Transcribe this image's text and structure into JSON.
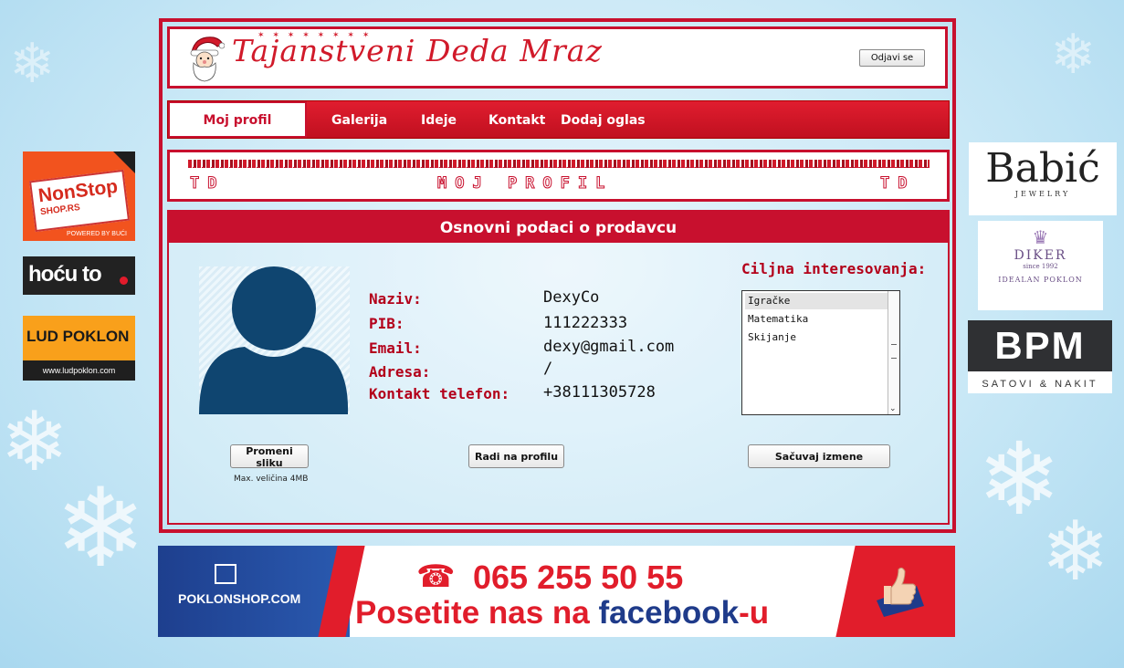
{
  "site": {
    "title": "Tajanstveni Deda Mraz",
    "logout_label": "Odjavi se"
  },
  "nav": {
    "items": [
      {
        "label": "Moj profil",
        "active": true
      },
      {
        "label": "Galerija"
      },
      {
        "label": "Ideje"
      },
      {
        "label": "Kontakt"
      },
      {
        "label": "Dodaj oglas"
      }
    ]
  },
  "banner": {
    "left": "TD",
    "main": "MOJ PROFIL",
    "right": "TD"
  },
  "panel": {
    "heading": "Osnovni podaci o prodavcu",
    "fields": [
      {
        "label": "Naziv:",
        "value": "DexyCo"
      },
      {
        "label": "PIB:",
        "value": "111222333"
      },
      {
        "label": "Email:",
        "value": "dexy@gmail.com"
      },
      {
        "label": "Adresa:",
        "value": "/"
      },
      {
        "label": "Kontakt telefon:",
        "value": "+38111305728"
      }
    ],
    "interests": {
      "label": "Ciljna interesovanja:",
      "options": [
        "Igračke",
        "Matematika",
        "Skijanje"
      ],
      "selected": "Igračke"
    },
    "buttons": {
      "change_photo": "Promeni sliku",
      "work_on_profile": "Radi na profilu",
      "save_changes": "Sačuvaj izmene"
    },
    "max_size_note": "Max. veličina 4MB"
  },
  "side_ads": {
    "nonstop": {
      "title": "NonStop",
      "subtitle": "SHOP.RS",
      "powered": "POWERED BY BUĆI"
    },
    "hocu": {
      "title": "hoću to"
    },
    "ludpoklon": {
      "title": "LUD POKLON",
      "url": "www.ludpoklon.com"
    },
    "babic": {
      "title": "Babić",
      "subtitle": "JEWELRY"
    },
    "diker": {
      "title": "DIKER",
      "since": "since 1992",
      "tagline": "IDEALAN POKLON"
    },
    "bpm": {
      "title": "BPM",
      "subtitle": "SATOVI & NAKIT"
    }
  },
  "bottom_ad": {
    "shop": "POKLONSHOP.COM",
    "phone": "065 255 50 55",
    "visit_prefix": "Posetite nas na ",
    "visit_brand": "facebook",
    "visit_suffix": "-u"
  },
  "colors": {
    "brand_red": "#c8102e",
    "avatar_blue": "#0f4570",
    "label_red": "#b3001a"
  }
}
